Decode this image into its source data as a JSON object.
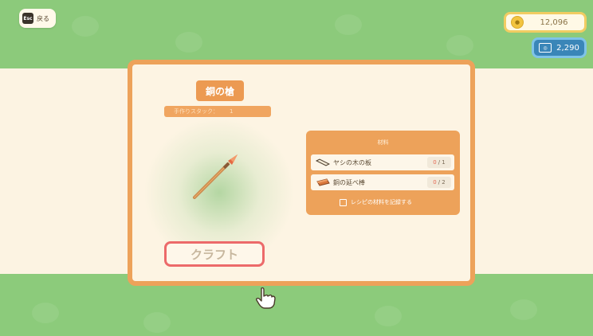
{
  "header": {
    "back_key": "Esc",
    "back_label": "戻る"
  },
  "currency": {
    "bells": "12,096",
    "miles": "2,290",
    "bells_icon": "bell-coin-icon",
    "miles_icon": "nook-miles-ticket-icon"
  },
  "item": {
    "title": "銅の槍",
    "stack_label": "手作りスタック：",
    "stack_count": "1",
    "icon": "copper-spear-icon"
  },
  "materials": {
    "header": "材料",
    "items": [
      {
        "name": "ヤシの木の板",
        "have": "0",
        "need": "/ 1",
        "icon": "palm-wood-plank-icon"
      },
      {
        "name": "銅の延べ棒",
        "have": "0",
        "need": "/ 2",
        "icon": "copper-ingot-icon"
      }
    ],
    "record_label": "レシピの材料を記録する"
  },
  "craft_button": "クラフト",
  "colors": {
    "panel_border": "#eda25a",
    "craft_border": "#ec6a6a",
    "have_count": "#e66a55",
    "grass": "#8ccb7b"
  }
}
